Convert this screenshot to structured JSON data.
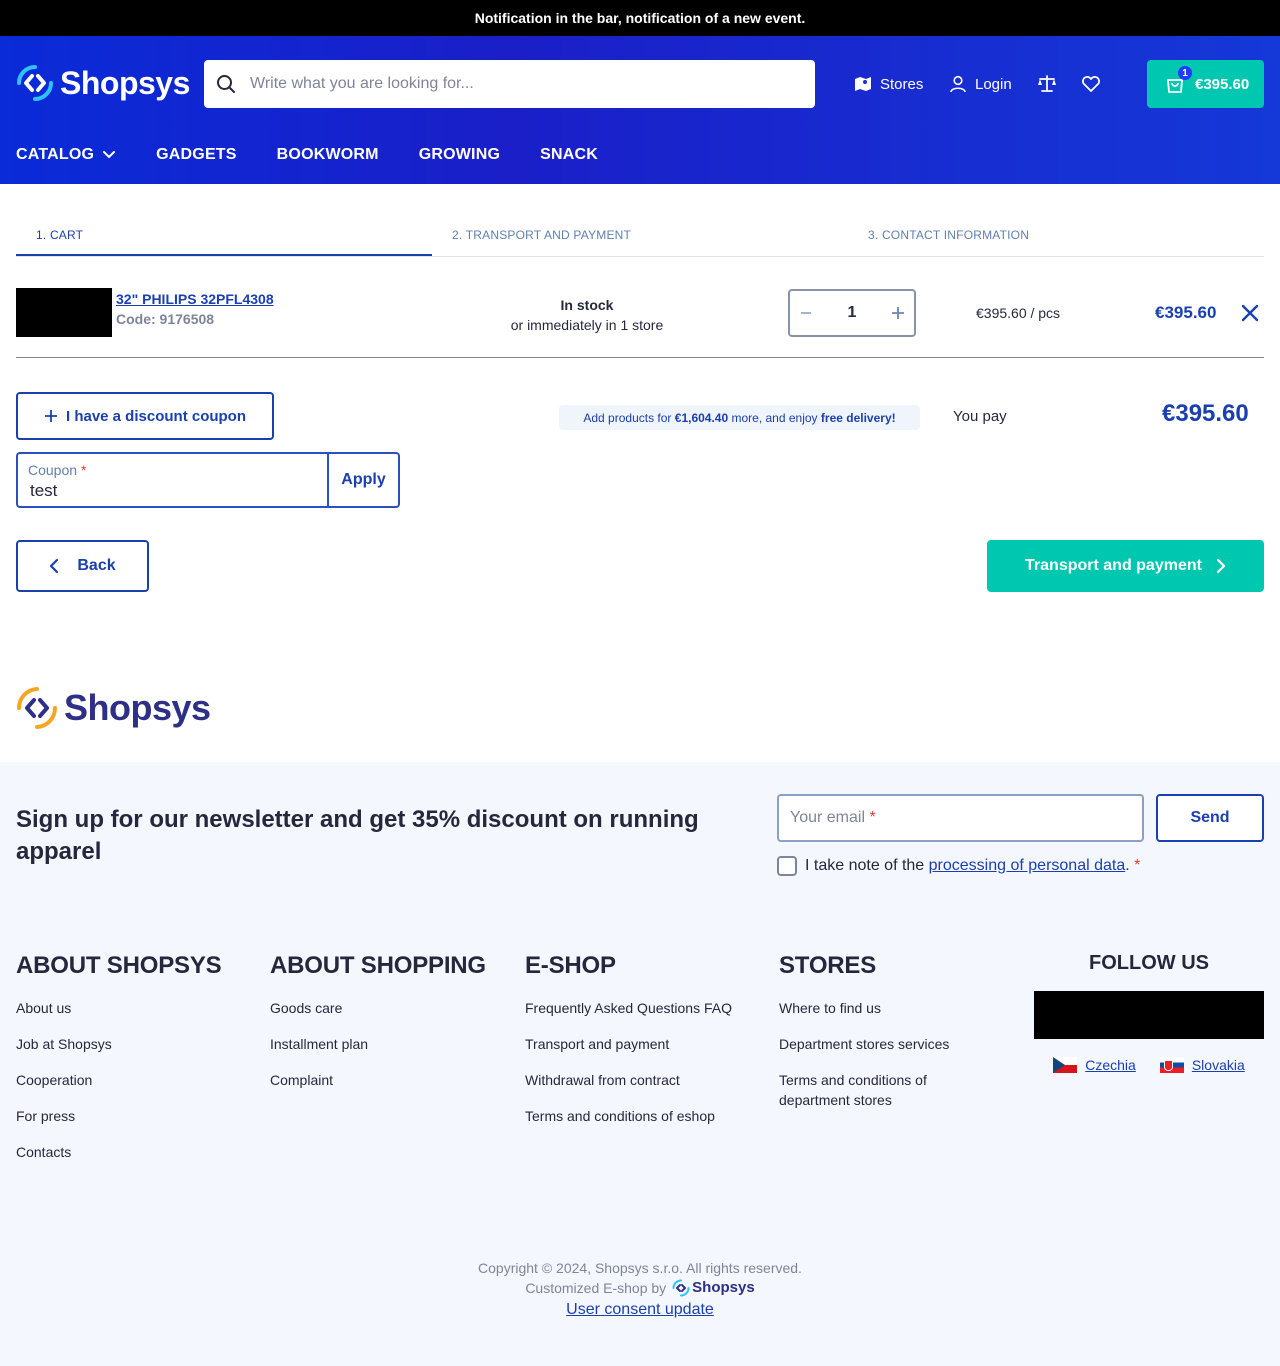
{
  "notification": "Notification in the bar, notification of a new event.",
  "header": {
    "logo": "Shopsys",
    "search_placeholder": "Write what you are looking for...",
    "stores_label": "Stores",
    "login_label": "Login",
    "cart_count": "1",
    "cart_total": "€395.60"
  },
  "nav": [
    {
      "label": "CATALOG"
    },
    {
      "label": "GADGETS"
    },
    {
      "label": "BOOKWORM"
    },
    {
      "label": "GROWING"
    },
    {
      "label": "SNACK"
    }
  ],
  "steps": [
    "1. CART",
    "2. TRANSPORT AND PAYMENT",
    "3. CONTACT INFORMATION"
  ],
  "cart_item": {
    "name": "32\" PHILIPS 32PFL4308",
    "code": "Code: 9176508",
    "stock": "In stock",
    "stock_detail": "or immediately in 1 store",
    "quantity": "1",
    "unit_price": "€395.60 / pcs",
    "total": "€395.60"
  },
  "coupon": {
    "toggle_label": "I have a discount coupon",
    "field_label": "Coupon",
    "value": "test",
    "apply_label": "Apply"
  },
  "free_delivery": {
    "prefix": "Add products for",
    "amount": "€1,604.40",
    "middle": "more, and enjoy",
    "emphasis": "free delivery!"
  },
  "summary": {
    "you_pay_label": "You pay",
    "total": "€395.60"
  },
  "actions": {
    "back_label": "Back",
    "next_label": "Transport and payment"
  },
  "footer_logo": "Shopsys",
  "newsletter": {
    "title": "Sign up for our newsletter and get 35% discount on running apparel",
    "email_placeholder": "Your email",
    "send_label": "Send",
    "consent_prefix": "I take note of the",
    "consent_link": "processing of personal data",
    "consent_suffix": "."
  },
  "footer_columns": [
    {
      "title": "ABOUT SHOPSYS",
      "links": [
        "About us",
        "Job at Shopsys",
        "Cooperation",
        "For press",
        "Contacts"
      ]
    },
    {
      "title": "ABOUT SHOPPING",
      "links": [
        "Goods care",
        "Installment plan",
        "Complaint"
      ]
    },
    {
      "title": "E-SHOP",
      "links": [
        "Frequently Asked Questions FAQ",
        "Transport and payment",
        "Withdrawal from contract",
        "Terms and conditions of eshop"
      ]
    },
    {
      "title": "STORES",
      "links": [
        "Where to find us",
        "Department stores services",
        "Terms and conditions of department stores"
      ]
    }
  ],
  "follow": {
    "title": "FOLLOW US",
    "countries": [
      "Czechia",
      "Slovakia"
    ]
  },
  "copyright": {
    "line1": "Copyright © 2024, Shopsys s.r.o. All rights reserved.",
    "line2": "Customized E-shop by",
    "brand": "Shopsys",
    "consent_link": "User consent update"
  },
  "colors": {
    "brand_blue": "#1a3fb0",
    "accent_teal": "#00c8b0",
    "header_gradient": "#0a2bd8"
  }
}
